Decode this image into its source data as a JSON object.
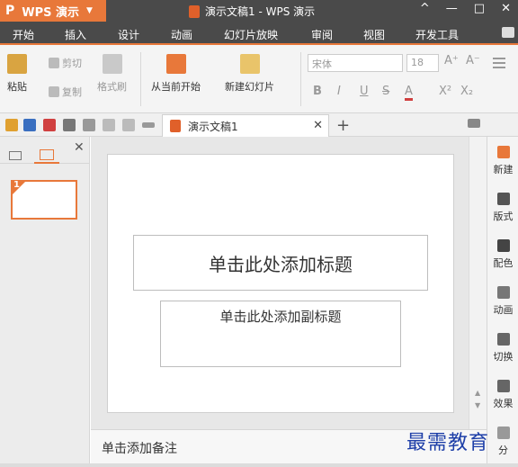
{
  "titlebar": {
    "app_name": "WPS 演示",
    "doc_title": "演示文稿1 - WPS 演示",
    "controls": [
      "^",
      "—",
      "□",
      "✕"
    ]
  },
  "menu": {
    "tabs": [
      "开始",
      "插入",
      "设计",
      "动画",
      "幻灯片放映",
      "审阅",
      "视图",
      "开发工具"
    ],
    "active": "开始"
  },
  "ribbon": {
    "paste": "粘贴",
    "cut": "剪切",
    "copy": "复制",
    "format_painter": "格式刷",
    "from_current": "从当前开始",
    "new_slide": "新建幻灯片",
    "font_name": "宋体",
    "font_size": "18",
    "bold": "B",
    "italic": "I",
    "underline": "U",
    "strike": "S",
    "font_color": "A",
    "superscript": "X²",
    "subscript": "X₂",
    "grow_font": "A⁺",
    "shrink_font": "A⁻"
  },
  "doc_tab": {
    "label": "演示文稿1",
    "close": "✕",
    "new_tab": "+"
  },
  "left_panel": {
    "close": "✕",
    "slide_number": "1"
  },
  "slide": {
    "title_placeholder": "单击此处添加标题",
    "subtitle_placeholder": "单击此处添加副标题"
  },
  "notes": {
    "placeholder": "单击添加备注"
  },
  "right_pane": {
    "items": [
      "新建",
      "版式",
      "配色",
      "动画",
      "切换",
      "效果",
      "分"
    ]
  },
  "watermark": "最需教育",
  "colors": {
    "accent": "#e8783a",
    "titlebar": "#4a4a4a",
    "watermark": "#1e3fa8"
  }
}
